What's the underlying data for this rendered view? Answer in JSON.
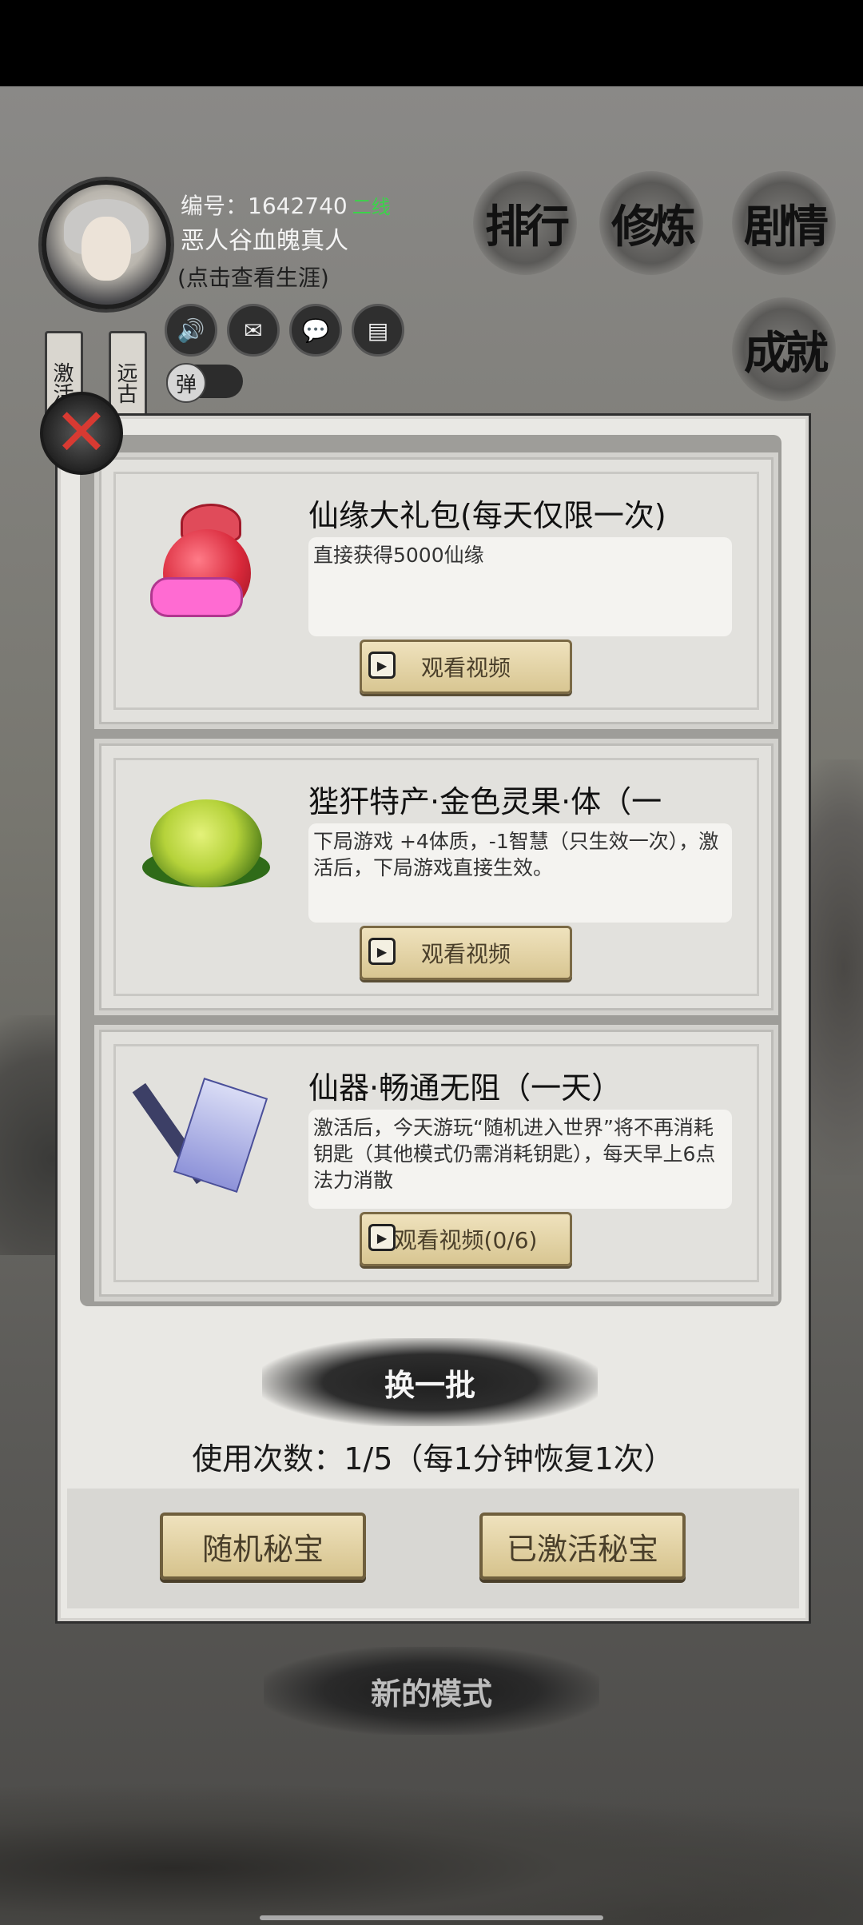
{
  "header": {
    "id_label": "编号：1642740",
    "server": "二线",
    "player_name": "恶人谷血魄真人",
    "career_link": "(点击查看生涯)",
    "toggle_label": "弹",
    "tags": [
      "激活",
      "远古"
    ],
    "icons": [
      "speaker-icon",
      "mail-icon",
      "chat-icon",
      "notice-icon"
    ]
  },
  "menu": {
    "rank": "排行",
    "cultivate": "修炼",
    "story": "剧情",
    "achievement": "成就"
  },
  "modal": {
    "cards": [
      {
        "title": "仙缘大礼包(每天仅限一次)",
        "desc": "直接获得5000仙缘",
        "button": "观看视频",
        "icon": "gift-bag-icon"
      },
      {
        "title": "狴犴特产·金色灵果·体（一",
        "desc": "下局游戏 +4体质，-1智慧（只生效一次），激活后，下局游戏直接生效。",
        "button": "观看视频",
        "icon": "golden-fruit-icon"
      },
      {
        "title": "仙器·畅通无阻（一天）",
        "desc": "激活后，今天游玩“随机进入世界”将不再消耗钥匙（其他模式仍需消耗钥匙），每天早上6点法力消散",
        "button": "观看视频(0/6)",
        "icon": "artifact-scroll-icon"
      }
    ],
    "refresh_label": "换一批",
    "usage_text": "使用次数：1/5（每1分钟恢复1次）",
    "random_treasure": "随机秘宝",
    "activated_treasure": "已激活秘宝"
  },
  "footer": {
    "new_mode": "新的模式"
  }
}
